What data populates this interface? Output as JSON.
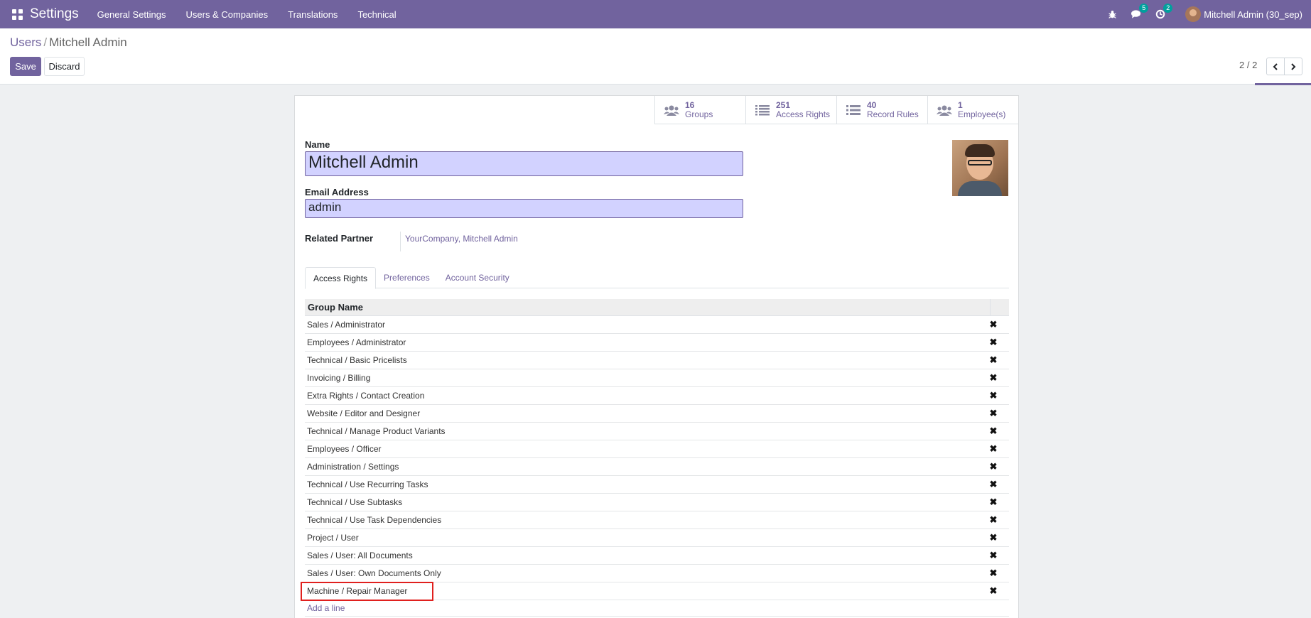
{
  "navbar": {
    "app_name": "Settings",
    "menu": [
      "General Settings",
      "Users & Companies",
      "Translations",
      "Technical"
    ],
    "messages_badge": "5",
    "activities_badge": "2",
    "user_name": "Mitchell Admin (30_sep)"
  },
  "control_panel": {
    "breadcrumb_parent": "Users",
    "breadcrumb_separator": "/",
    "breadcrumb_current": "Mitchell Admin",
    "save_label": "Save",
    "discard_label": "Discard",
    "pager_value": "2 / 2"
  },
  "stat_buttons": [
    {
      "value": "16",
      "label": "Groups",
      "icon": "users-icon"
    },
    {
      "value": "251",
      "label": "Access Rights",
      "icon": "list-icon"
    },
    {
      "value": "40",
      "label": "Record Rules",
      "icon": "list-icon"
    },
    {
      "value": "1",
      "label": "Employee(s)",
      "icon": "users-icon"
    }
  ],
  "form": {
    "name_label": "Name",
    "name_value": "Mitchell Admin",
    "email_label": "Email Address",
    "email_value": "admin",
    "partner_label": "Related Partner",
    "partner_value": "YourCompany, Mitchell Admin"
  },
  "tabs": [
    "Access Rights",
    "Preferences",
    "Account Security"
  ],
  "table": {
    "header": "Group Name",
    "rows": [
      "Sales / Administrator",
      "Employees / Administrator",
      "Technical / Basic Pricelists",
      "Invoicing / Billing",
      "Extra Rights / Contact Creation",
      "Website / Editor and Designer",
      "Technical / Manage Product Variants",
      "Employees / Officer",
      "Administration / Settings",
      "Technical / Use Recurring Tasks",
      "Technical / Use Subtasks",
      "Technical / Use Task Dependencies",
      "Project / User",
      "Sales / User: All Documents",
      "Sales / User: Own Documents Only",
      "Machine / Repair Manager"
    ],
    "delete_glyph": "✖",
    "add_line": "Add a line"
  },
  "colors": {
    "brand": "#71639e",
    "input_bg": "#d2d2ff",
    "highlight": "#e0201e",
    "badge": "#00a09d"
  }
}
